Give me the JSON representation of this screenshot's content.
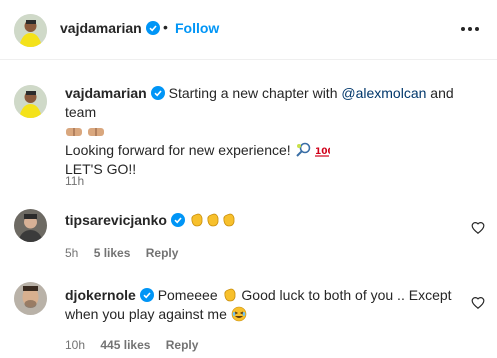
{
  "post": {
    "username": "vajdamarian",
    "separator": "•",
    "follow_label": "Follow"
  },
  "caption": {
    "username": "vajdamarian",
    "text_before_mention": "Starting a new chapter with",
    "mention": "@alexmolcan",
    "text_after_mention": "and team",
    "line2": "Looking forward for new experience!",
    "line3": "LET'S GO!!",
    "time": "11h"
  },
  "comments": [
    {
      "username": "tipsarevicjanko",
      "emojis": [
        "clapping-hands",
        "clapping-hands",
        "clapping-hands"
      ],
      "time": "5h",
      "likes": "5 likes",
      "reply": "Reply"
    },
    {
      "username": "djokernole",
      "text_line1_a": "Pomeeee",
      "text_line1_b": "Good luck to both of you .. Except",
      "text_line2": "when you play against me",
      "time": "10h",
      "likes": "445 likes",
      "reply": "Reply"
    }
  ],
  "colors": {
    "accent": "#0095f6",
    "mention": "#00376b",
    "meta": "#737373",
    "verified": "#0095f6"
  }
}
